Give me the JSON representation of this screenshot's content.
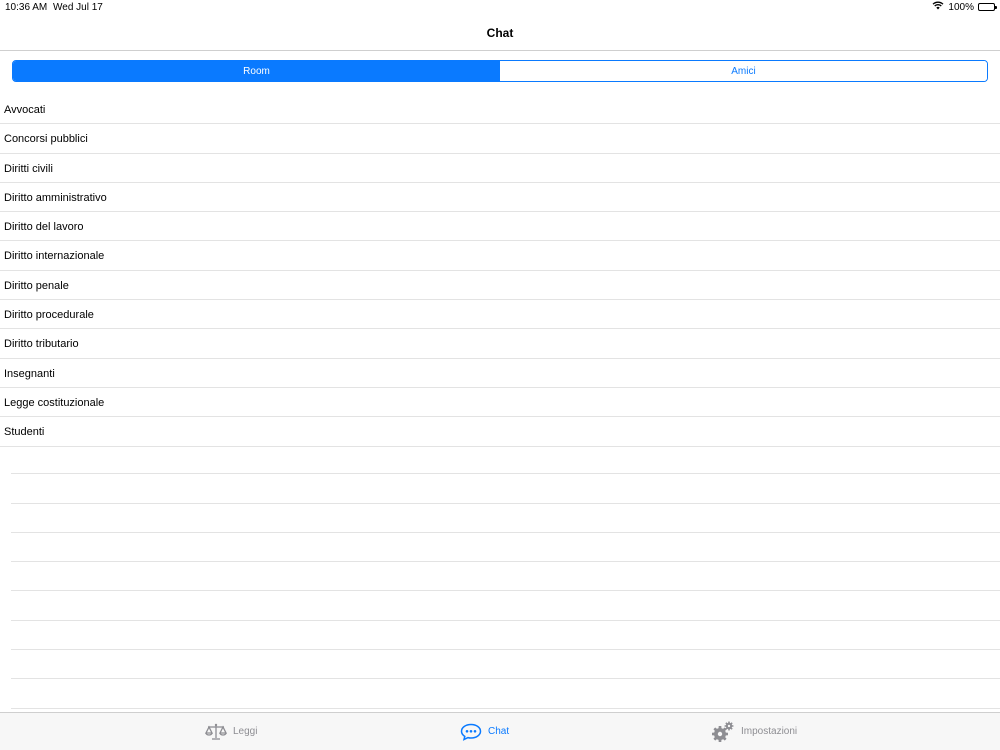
{
  "status_bar": {
    "time": "10:36 AM",
    "date": "Wed Jul 17",
    "battery_text": "100%"
  },
  "nav": {
    "title": "Chat"
  },
  "segments": [
    {
      "label": "Room",
      "selected": true
    },
    {
      "label": "Amici",
      "selected": false
    }
  ],
  "rooms": [
    {
      "label": "Avvocati"
    },
    {
      "label": "Concorsi pubblici"
    },
    {
      "label": "Diritti civili"
    },
    {
      "label": "Diritto amministrativo"
    },
    {
      "label": "Diritto del lavoro"
    },
    {
      "label": "Diritto internazionale"
    },
    {
      "label": "Diritto penale"
    },
    {
      "label": "Diritto procedurale"
    },
    {
      "label": "Diritto tributario"
    },
    {
      "label": "Insegnanti"
    },
    {
      "label": "Legge costituzionale"
    },
    {
      "label": "Studenti"
    }
  ],
  "tab_bar": {
    "tabs": [
      {
        "label": "Leggi",
        "icon": "scales-icon",
        "active": false
      },
      {
        "label": "Chat",
        "icon": "chat-bubble-icon",
        "active": true
      },
      {
        "label": "Impostazioni",
        "icon": "gears-icon",
        "active": false
      }
    ]
  },
  "colors": {
    "accent": "#0a7aff",
    "inactive_tab": "#8e8e93",
    "separator": "#e3e3e3"
  }
}
